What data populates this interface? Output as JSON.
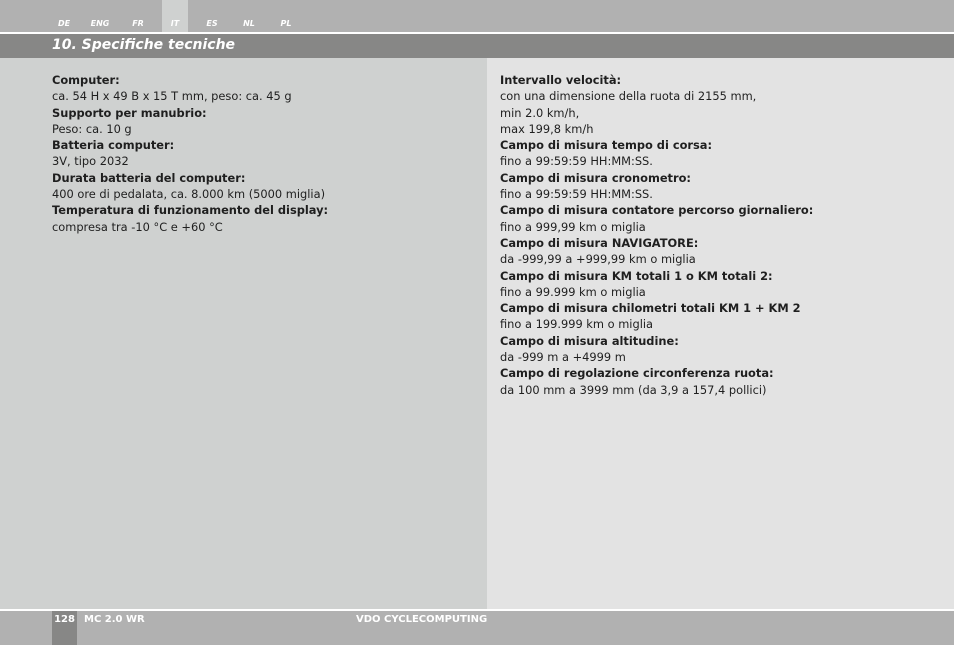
{
  "languages": [
    {
      "code": "DE",
      "active": false
    },
    {
      "code": "ENG",
      "active": false
    },
    {
      "code": "FR",
      "active": false
    },
    {
      "code": "IT",
      "active": true
    },
    {
      "code": "ES",
      "active": false
    },
    {
      "code": "NL",
      "active": false
    },
    {
      "code": "PL",
      "active": false
    }
  ],
  "section_title": "10.  Specifiche tecniche",
  "left_specs": [
    {
      "label": "Computer:",
      "lines": [
        "ca. 54 H x 49 B x 15 T mm, peso: ca. 45 g"
      ]
    },
    {
      "label": "Supporto per manubrio:",
      "lines": [
        "Peso: ca. 10 g"
      ]
    },
    {
      "label": "Batteria computer:",
      "lines": [
        "3V, tipo 2032"
      ]
    },
    {
      "label": "Durata batteria del computer:",
      "lines": [
        "400 ore di pedalata, ca. 8.000 km (5000 miglia)"
      ]
    },
    {
      "label": "Temperatura di funzionamento del display:",
      "lines": [
        "compresa tra -10 °C e +60 °C"
      ]
    }
  ],
  "right_specs": [
    {
      "label": "Intervallo velocità:",
      "lines": [
        "con una dimensione della ruota di 2155 mm,",
        "min 2.0 km/h,",
        "max 199,8 km/h"
      ]
    },
    {
      "label": "Campo di misura tempo di corsa:",
      "lines": [
        "fino a 99:59:59 HH:MM:SS."
      ]
    },
    {
      "label": "Campo di misura cronometro:",
      "lines": [
        "fino a 99:59:59 HH:MM:SS."
      ]
    },
    {
      "label": "Campo di misura contatore percorso giornaliero:",
      "lines": [
        "fino a 999,99 km o miglia"
      ]
    },
    {
      "label": "Campo di misura NAVIGATORE:",
      "lines": [
        "da -999,99 a +999,99 km o miglia"
      ]
    },
    {
      "label": "Campo di misura KM totali 1 o KM totali 2:",
      "lines": [
        "fino a 99.999 km o miglia"
      ]
    },
    {
      "label": "Campo di misura chilometri totali KM 1 + KM 2",
      "lines": [
        "fino a 199.999 km o miglia"
      ]
    },
    {
      "label": "Campo di misura altitudine:",
      "lines": [
        "da -999 m a +4999 m"
      ]
    },
    {
      "label": "Campo di regolazione circonferenza ruota:",
      "lines": [
        "da 100 mm a 3999 mm (da 3,9 a 157,4 pollici)"
      ]
    }
  ],
  "footer": {
    "page_number": "128",
    "product": "MC 2.0 WR",
    "brand": "VDO CYCLECOMPUTING"
  }
}
